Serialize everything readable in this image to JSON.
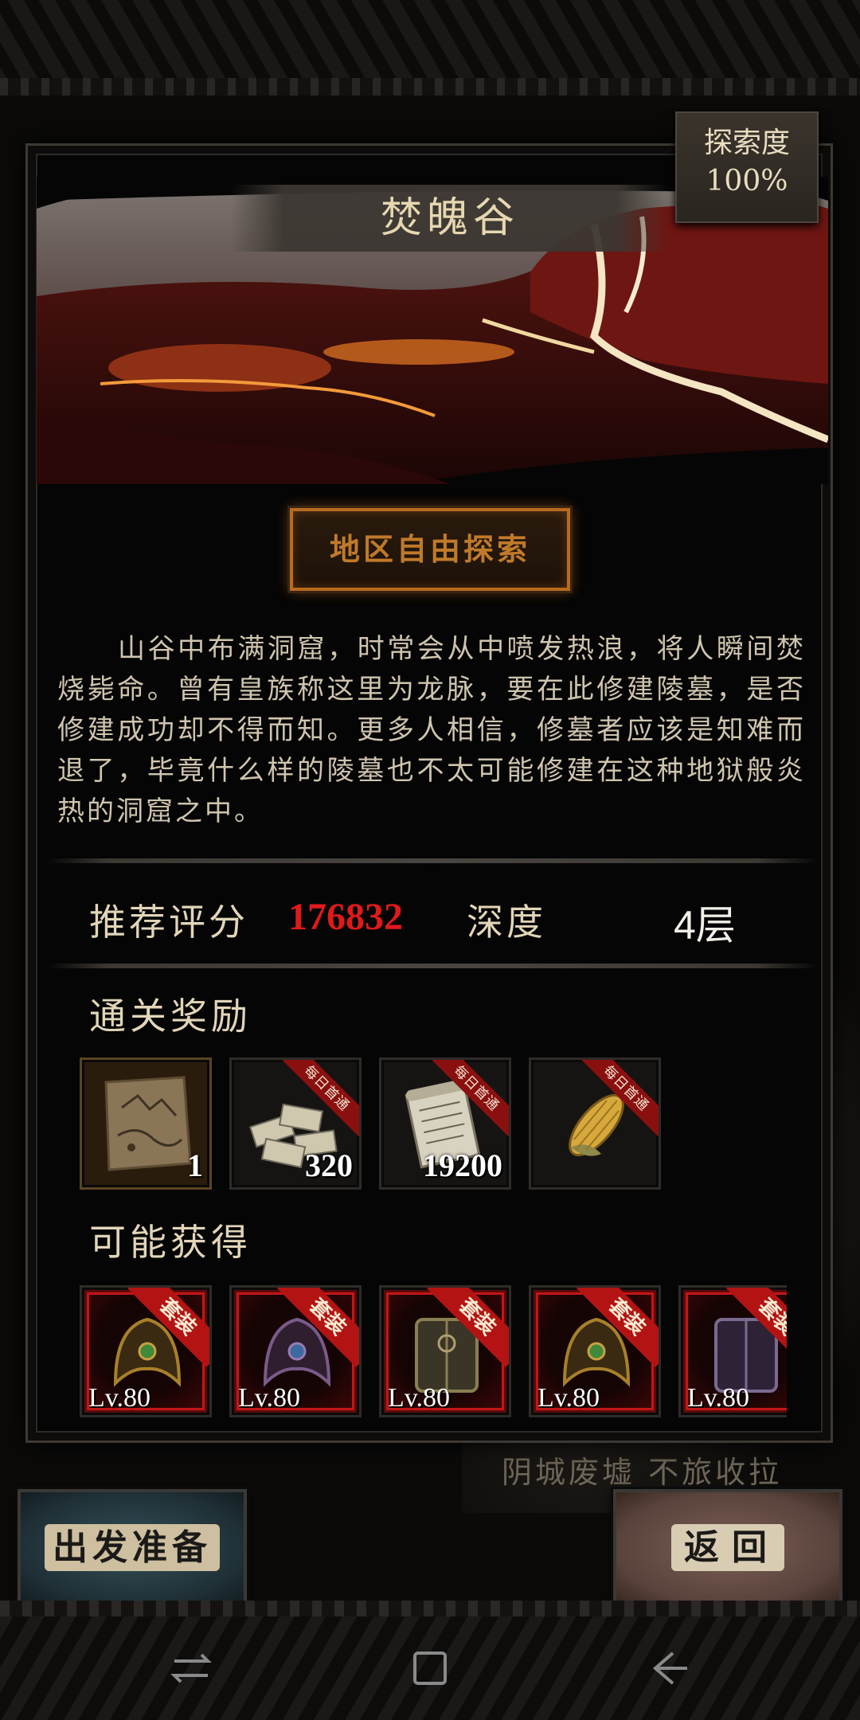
{
  "region": {
    "title": "焚魄谷",
    "explore_label": "探索度",
    "explore_value": "100%",
    "free_explore_button": "地区自由探索",
    "description": "山谷中布满洞窟，时常会从中喷发热浪，将人瞬间焚烧毙命。曾有皇族称这里为龙脉，要在此修建陵墓，是否修建成功却不得而知。更多人相信，修墓者应该是知难而退了，毕竟什么样的陵墓也不太可能修建在这种地狱般炎热的洞窟之中。"
  },
  "stats": {
    "score_label": "推荐评分",
    "score_value": "176832",
    "depth_label": "深度",
    "depth_value": "4层"
  },
  "rewards": {
    "title": "通关奖励",
    "items": [
      {
        "icon": "map-scroll-icon",
        "qty": "1",
        "ribbon": ""
      },
      {
        "icon": "banknotes-icon",
        "qty": "320",
        "ribbon": "每日首通"
      },
      {
        "icon": "scroll-document-icon",
        "qty": "19200",
        "ribbon": "每日首通"
      },
      {
        "icon": "corn-icon",
        "qty": "",
        "ribbon": "每日首通"
      }
    ]
  },
  "possible": {
    "title": "可能获得",
    "items": [
      {
        "icon": "helmet-gold-icon",
        "level": "Lv.80",
        "ribbon": "套装"
      },
      {
        "icon": "helmet-purple-icon",
        "level": "Lv.80",
        "ribbon": "套装"
      },
      {
        "icon": "armor-bronze-icon",
        "level": "Lv.80",
        "ribbon": "套装"
      },
      {
        "icon": "helmet-gold-icon",
        "level": "Lv.80",
        "ribbon": "套装"
      },
      {
        "icon": "armor-purple-icon",
        "level": "Lv.80",
        "ribbon": "套装"
      }
    ]
  },
  "buttons": {
    "depart": "出发准备",
    "back": "返回"
  },
  "background": {
    "map_label": "阴城废墟  不旅收拉"
  },
  "colors": {
    "score_red": "#e0191b",
    "button_orange": "#b86a1e",
    "set_ribbon_red": "#b31313"
  }
}
